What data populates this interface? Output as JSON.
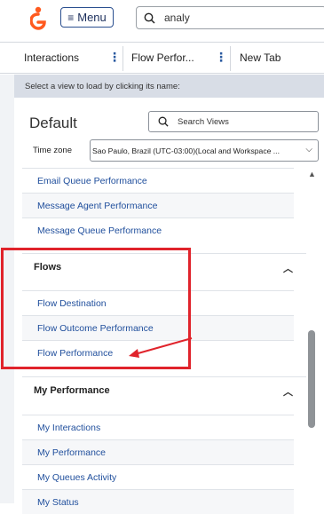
{
  "header": {
    "menu_label": "Menu",
    "search_value": "analy"
  },
  "tabs": [
    {
      "label": "Interactions"
    },
    {
      "label": "Flow Perfor..."
    },
    {
      "label": "New Tab"
    }
  ],
  "hint": "Select a view to load by clicking its name:",
  "panel": {
    "title": "Default",
    "search_placeholder": "Search Views",
    "timezone_label": "Time zone",
    "timezone_value": "Sao Paulo, Brazil (UTC-03:00)(Local and Workspace ..."
  },
  "list": {
    "top_items": [
      "Email Queue Performance",
      "Message Agent Performance",
      "Message Queue Performance"
    ],
    "flows": {
      "title": "Flows",
      "items": [
        "Flow Destination",
        "Flow Outcome Performance",
        "Flow Performance"
      ]
    },
    "my_performance": {
      "title": "My Performance",
      "items": [
        "My Interactions",
        "My Performance",
        "My Queues Activity",
        "My Status"
      ]
    }
  },
  "colors": {
    "accent": "#e0232b",
    "link": "#1f4e9c",
    "brand_orange": "#ff5a1f"
  },
  "icons": [
    "genesys-logo-icon",
    "hamburger-icon",
    "search-icon",
    "more-vertical-icon",
    "chevron-down-icon",
    "chevron-up-icon"
  ]
}
